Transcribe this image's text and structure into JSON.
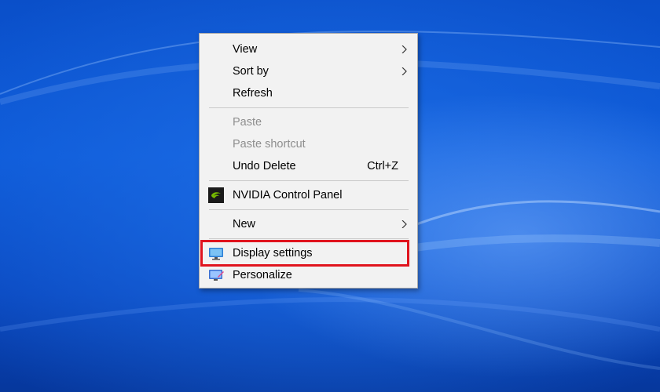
{
  "menu": {
    "items": [
      {
        "label": "View",
        "submenu": true
      },
      {
        "label": "Sort by",
        "submenu": true
      },
      {
        "label": "Refresh"
      },
      {
        "label": "Paste",
        "disabled": true
      },
      {
        "label": "Paste shortcut",
        "disabled": true
      },
      {
        "label": "Undo Delete",
        "shortcut": "Ctrl+Z"
      },
      {
        "label": "NVIDIA Control Panel",
        "icon": "nvidia-icon"
      },
      {
        "label": "New",
        "submenu": true
      },
      {
        "label": "Display settings",
        "icon": "display-icon",
        "highlighted": true
      },
      {
        "label": "Personalize",
        "icon": "personalize-icon"
      }
    ]
  },
  "colors": {
    "highlight_border": "#e0141e",
    "menu_background": "#f2f2f2",
    "disabled_text": "#8e8e8e"
  }
}
